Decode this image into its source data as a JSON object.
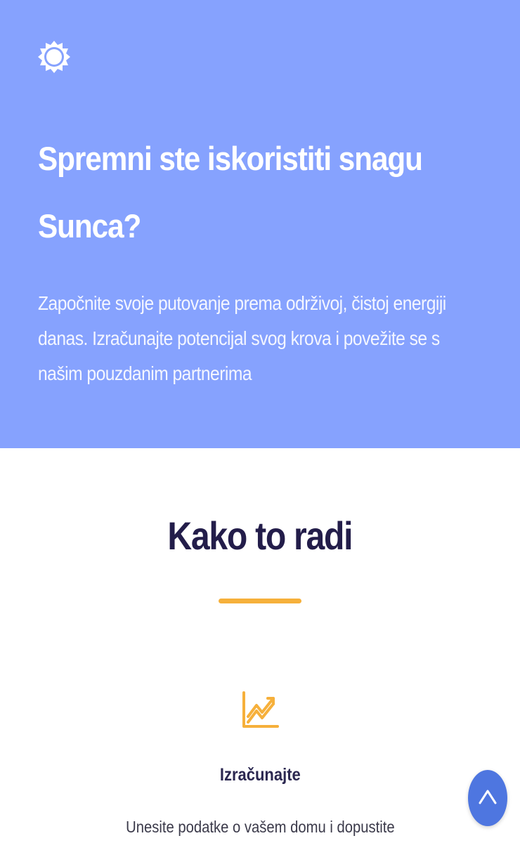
{
  "hero": {
    "icon": "sun-icon",
    "title": "Spremni ste iskoristiti snagu Sunca?",
    "text": "Započnite svoje putovanje prema održivoj, čistoj energiji danas. Izračunajte potencijal svog krova i povežite se s našim pouzdanim partnerima",
    "background_color": "#86a2fe"
  },
  "how_it_works": {
    "title": "Kako to radi",
    "divider_color": "#f6b03b",
    "step": {
      "icon": "chart-trend-icon",
      "title": "Izračunajte",
      "text": "Unesite podatke o vašem domu i dopustite"
    }
  },
  "scroll_top": {
    "icon": "chevron-up-icon",
    "color": "#4e76e0"
  }
}
